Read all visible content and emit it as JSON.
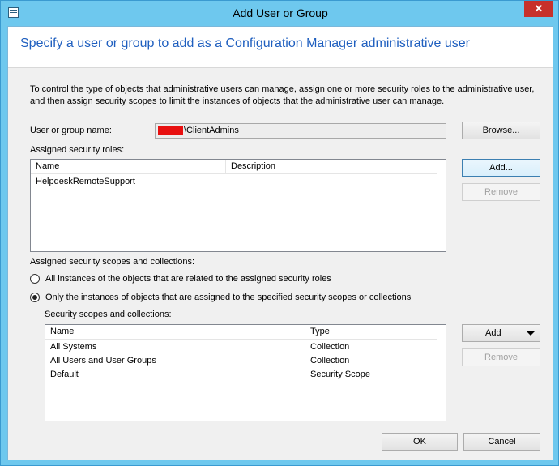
{
  "window": {
    "title": "Add User or Group",
    "close_glyph": "✕"
  },
  "header": {
    "title": "Specify a user or group to add as a Configuration Manager administrative user"
  },
  "instructions": "To control the type of objects that administrative users can manage, assign one or more security roles  to the  administrative user, and then assign security scopes to limit the instances of objects that the administrative user can manage.",
  "user_field": {
    "label": "User or group name:",
    "value": "\\ClientAdmins",
    "browse_label": "Browse..."
  },
  "roles": {
    "label": "Assigned security roles:",
    "columns": [
      "Name",
      "Description"
    ],
    "rows": [
      {
        "name": "HelpdeskRemoteSupport",
        "description": ""
      }
    ],
    "add_label": "Add...",
    "remove_label": "Remove"
  },
  "scopes": {
    "label": "Assigned security scopes and collections:",
    "option_all": "All instances of the objects that are related to the assigned security roles",
    "option_specific": "Only the instances of objects that are assigned to the specified security scopes or collections",
    "list_label": "Security scopes and collections:",
    "columns": [
      "Name",
      "Type"
    ],
    "rows": [
      {
        "name": "All Systems",
        "type": "Collection"
      },
      {
        "name": "All Users and User Groups",
        "type": "Collection"
      },
      {
        "name": "Default",
        "type": "Security Scope"
      }
    ],
    "add_label": "Add",
    "remove_label": "Remove"
  },
  "footer": {
    "ok_label": "OK",
    "cancel_label": "Cancel"
  }
}
